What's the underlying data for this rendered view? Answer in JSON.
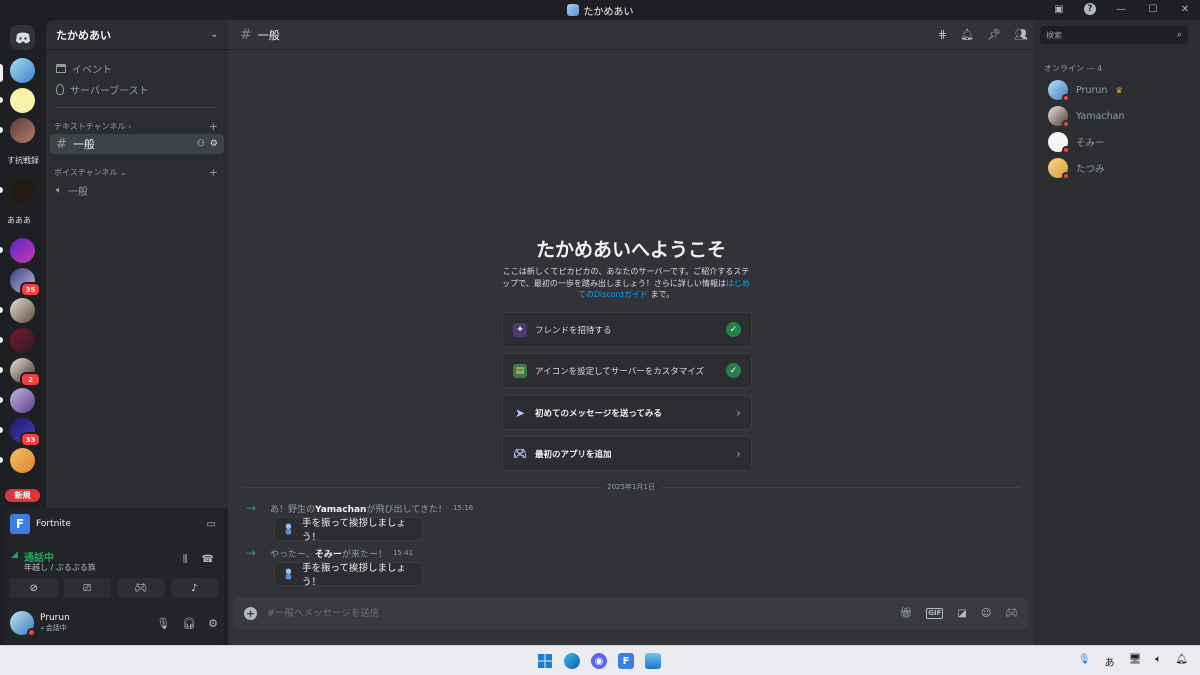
{
  "window": {
    "title": "たかめあい"
  },
  "rail": {
    "text_items": [
      "す抗戦録",
      "あああ"
    ],
    "badges": [
      "35",
      "2",
      "33"
    ],
    "new_label": "新規"
  },
  "sidebar": {
    "server_name": "たかめあい",
    "items": [
      {
        "label": "イベント",
        "icon": "calendar-icon"
      },
      {
        "label": "サーバーブースト",
        "icon": "boost-icon"
      }
    ],
    "text_category": "テキストチャンネル",
    "text_channel": "一般",
    "voice_category": "ボイスチャンネル",
    "voice_channel": "一般"
  },
  "panel": {
    "game": "Fortnite",
    "voice_status": "通話中",
    "voice_channel": "年越し / ぷるぷる族",
    "user": {
      "name": "Prurun",
      "status": "会話中"
    }
  },
  "header": {
    "channel": "一般"
  },
  "welcome": {
    "title": "たかめあいへようこそ",
    "desc_1": "ここは新しくてピカピカの、あなたのサーバーです。ご紹介するステップで、最初の一歩を踏み出しましょう！さらに詳しい情報は",
    "desc_link": "はじめてのDiscordガイド",
    "desc_2": "まで。",
    "steps": [
      {
        "label": "フレンドを招待する",
        "done": true
      },
      {
        "label": "アイコンを設定してサーバーをカスタマイズ",
        "done": true
      },
      {
        "label": "初めてのメッセージを送ってみる",
        "done": false
      },
      {
        "label": "最初のアプリを追加",
        "done": false
      }
    ]
  },
  "messages": {
    "date": "2025年1月1日",
    "items": [
      {
        "pre": "あ！野生の",
        "user": "Yamachan",
        "post": "が飛び出してきた！",
        "time": "15:16",
        "button": "手を振って挨拶しましょう！"
      },
      {
        "pre": "やったー、",
        "user": "そみー",
        "post": "が来たー！",
        "time": "15:41",
        "button": "手を振って挨拶しましょう！"
      }
    ]
  },
  "composer": {
    "placeholder": "#一般へメッセージを送信"
  },
  "members": {
    "search_placeholder": "検索",
    "online_header": "オンライン — 4",
    "list": [
      {
        "name": "Prurun",
        "owner": true
      },
      {
        "name": "Yamachan",
        "owner": false
      },
      {
        "name": "そみー",
        "owner": false
      },
      {
        "name": "たつみ",
        "owner": false
      }
    ]
  },
  "taskbar": {
    "ime": "あ"
  },
  "colors": {
    "accent": "#5865f2",
    "online_green": "#23a55a",
    "dnd_red": "#f23f43",
    "link": "#00a8fc"
  }
}
